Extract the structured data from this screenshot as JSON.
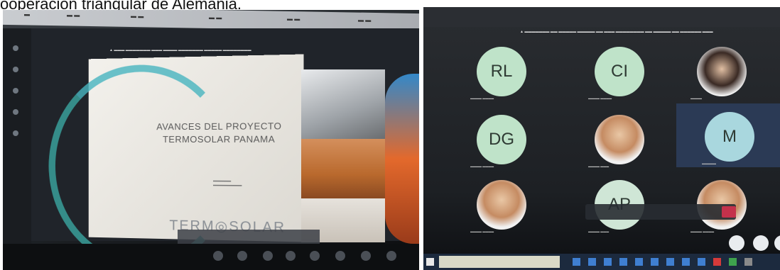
{
  "caption": "ooperación triangular de Alemania.",
  "left_photo": {
    "slide_title_line1": "AVANCES DEL PROYECTO",
    "slide_title_line2": "TERMOSOLAR PANAMA",
    "slide_logo": "TERM◎SOLAR"
  },
  "right_photo": {
    "tiles": [
      {
        "type": "initials",
        "text": "RL",
        "color": "#bfe3c9"
      },
      {
        "type": "initials",
        "text": "CI",
        "color": "#bfe3c9"
      },
      {
        "type": "photo",
        "text": ""
      },
      {
        "type": "initials",
        "text": "DG",
        "color": "#bfe3c9"
      },
      {
        "type": "photo",
        "text": ""
      },
      {
        "type": "initials",
        "text": "M",
        "color": "#a9d7de"
      },
      {
        "type": "photo",
        "text": ""
      },
      {
        "type": "initials",
        "text": "AP",
        "color": "#cfe6d6"
      },
      {
        "type": "photo",
        "text": ""
      }
    ]
  }
}
